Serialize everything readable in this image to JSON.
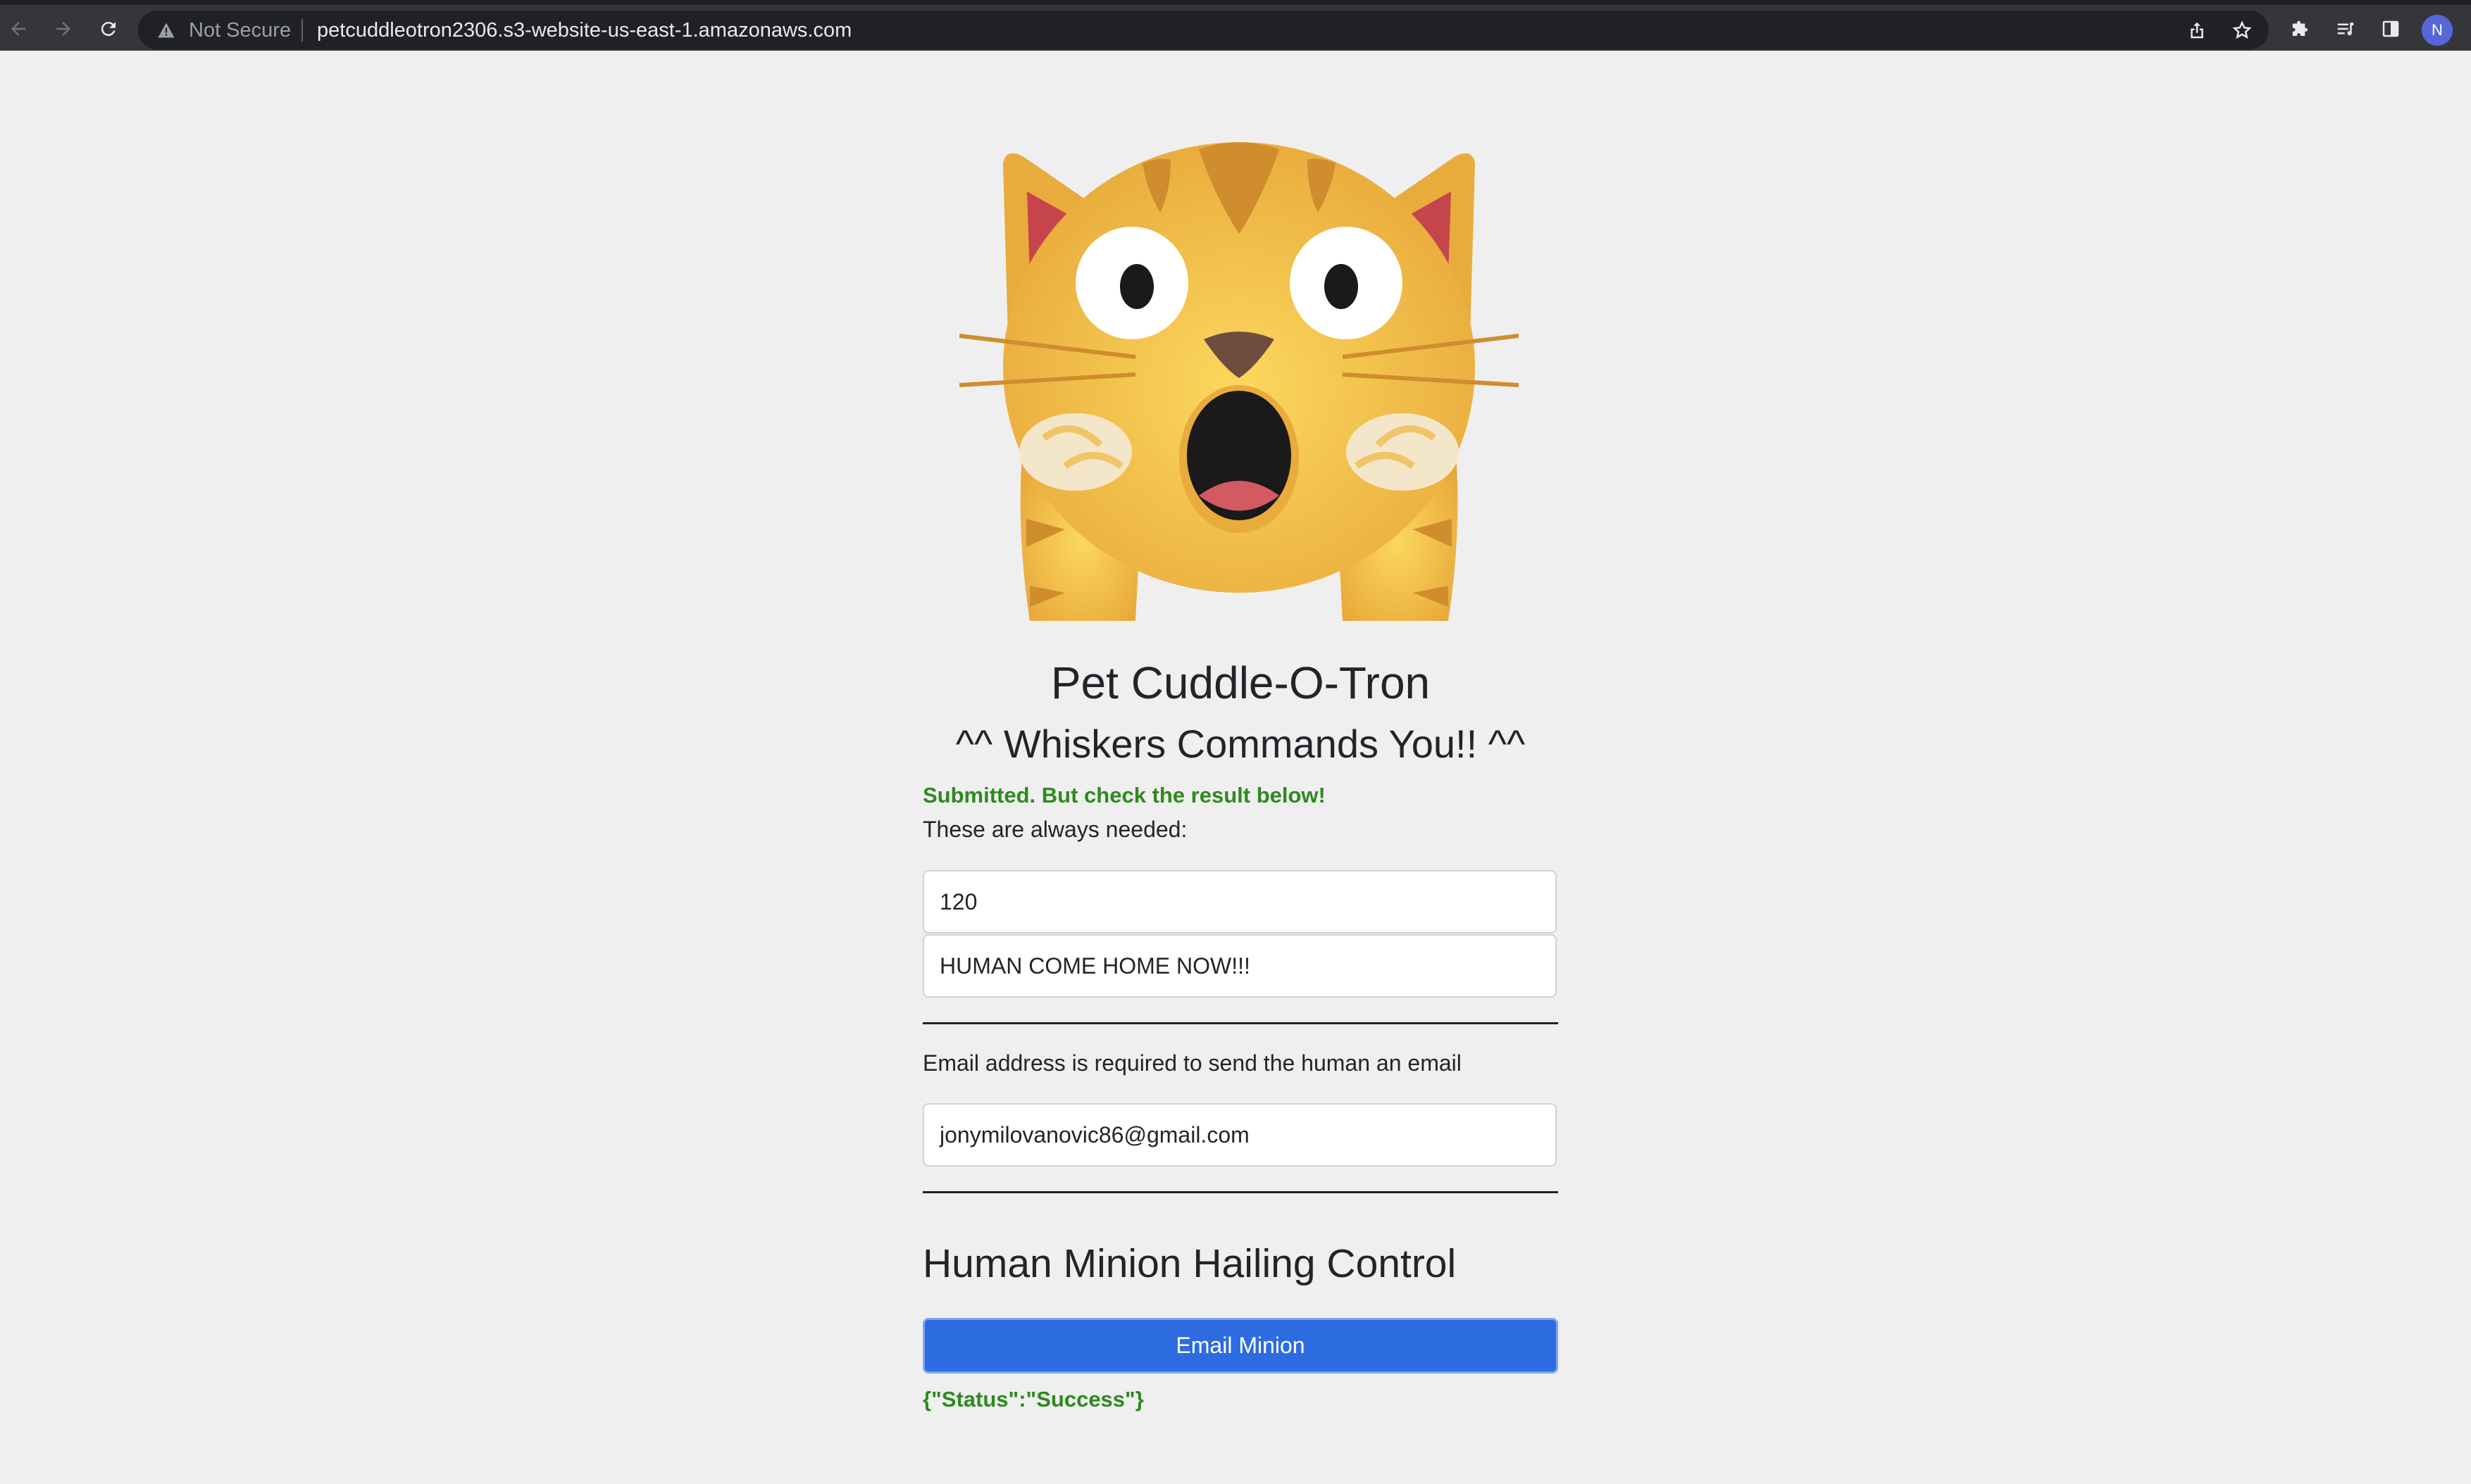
{
  "browser": {
    "security_label": "Not Secure",
    "url": "petcuddleotron2306.s3-website-us-east-1.amazonaws.com",
    "profile_initial": "N",
    "icons": [
      "back-icon",
      "forward-icon",
      "reload-icon",
      "warning-icon",
      "share-icon",
      "bookmark-star-icon",
      "extensions-icon",
      "reading-list-icon",
      "side-panel-icon"
    ]
  },
  "page": {
    "title": "Pet Cuddle-O-Tron",
    "subtitle": "^^ Whiskers Commands You!! ^^",
    "submit_notice": "Submitted. But check the result below!",
    "always_needed_label": "These are always needed:",
    "waitseconds_value": "120",
    "message_value": "HUMAN COME HOME NOW!!!",
    "email_label": "Email address is required to send the human an email",
    "email_value": "jonymilovanovic86@gmail.com",
    "control_heading": "Human Minion Hailing Control",
    "email_button_label": "Email Minion",
    "result_text": "{\"Status\":\"Success\"}",
    "accent_green": "#2d8a1e",
    "button_blue": "#2d6be0"
  }
}
